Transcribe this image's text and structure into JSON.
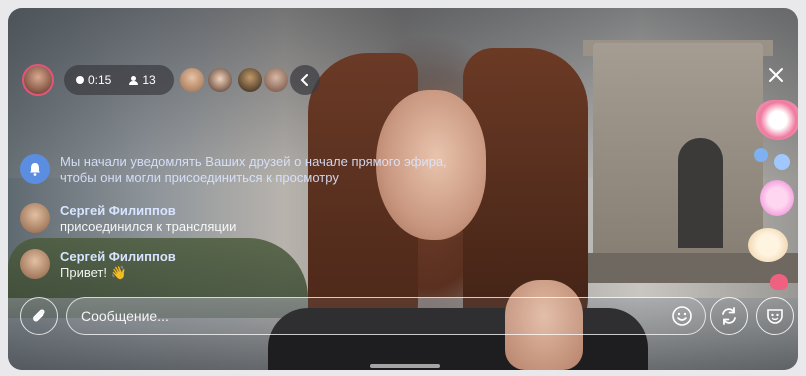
{
  "stream": {
    "duration": "0:15",
    "viewers_count": "13"
  },
  "messages": [
    {
      "type": "system",
      "text": "Мы начали уведомлять Ваших друзей о начале прямого эфира, чтобы они могли присоединиться к просмотру",
      "icon": "bell-icon"
    },
    {
      "type": "user",
      "name": "Сергей Филиппов",
      "text": "присоединился к трансляции"
    },
    {
      "type": "user",
      "name": "Сергей Филиппов",
      "text": "Привет! 👋"
    }
  ],
  "composer": {
    "placeholder": "Сообщение..."
  },
  "icons": {
    "attach": "paperclip-icon",
    "emoji": "smile-icon",
    "switch_camera": "refresh-icon",
    "mask": "mask-icon",
    "close": "close-icon",
    "collapse": "chevron-left-icon"
  },
  "colors": {
    "host_ring": "#e0567a",
    "system_avatar": "#5b8de0"
  }
}
